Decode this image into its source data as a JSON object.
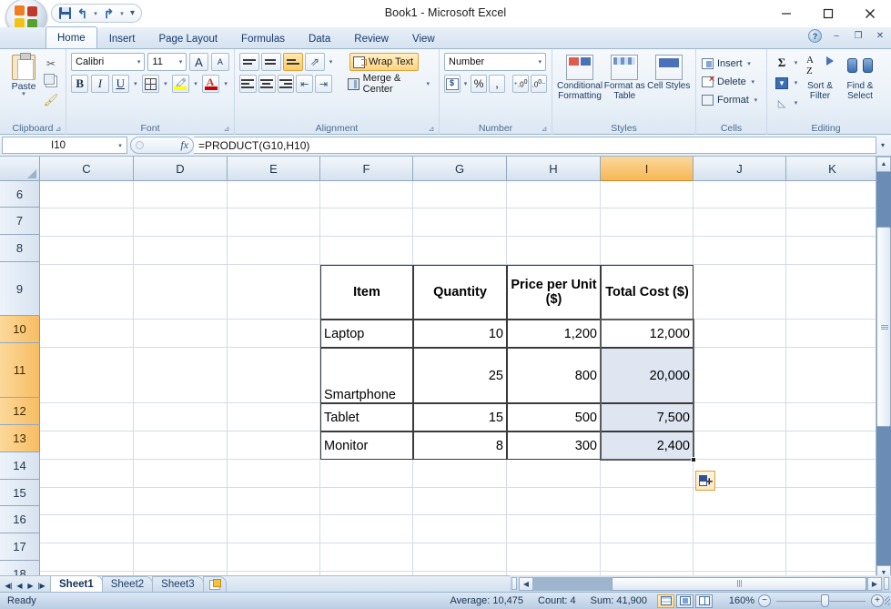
{
  "window": {
    "title": "Book1 - Microsoft Excel",
    "minimize": "−",
    "maximize": "□",
    "close": "✕"
  },
  "quick_access": {
    "save": "save-icon",
    "undo": "↰",
    "redo": "↱",
    "customize": "▾"
  },
  "ribbon": {
    "tabs": [
      {
        "label": "Home",
        "active": true
      },
      {
        "label": "Insert",
        "active": false
      },
      {
        "label": "Page Layout",
        "active": false
      },
      {
        "label": "Formulas",
        "active": false
      },
      {
        "label": "Data",
        "active": false
      },
      {
        "label": "Review",
        "active": false
      },
      {
        "label": "View",
        "active": false
      }
    ],
    "doc_controls": {
      "minimize": "–",
      "restore": "❐",
      "close": "✕"
    },
    "groups": {
      "clipboard": {
        "label": "Clipboard",
        "paste": "Paste",
        "cut": "✂",
        "copy": "copy-icon",
        "format_painter": "🖌"
      },
      "font": {
        "label": "Font",
        "font_name": "Calibri",
        "font_size": "11",
        "grow_font": "A",
        "shrink_font": "A",
        "bold": "B",
        "italic": "I",
        "underline": "U",
        "borders": "borders-icon",
        "fill_color": "fill-color-icon",
        "font_color": "A"
      },
      "alignment": {
        "label": "Alignment",
        "top_align": "top-align-icon",
        "middle_align": "middle-align-icon",
        "bottom_align": "bottom-align-icon",
        "orientation": "orientation-icon",
        "align_left": "align-left-icon",
        "align_center": "align-center-icon",
        "align_right": "align-right-icon",
        "decrease_indent": "decrease-indent-icon",
        "increase_indent": "increase-indent-icon",
        "wrap_text": "Wrap Text",
        "wrap_text_active": true,
        "merge_center": "Merge & Center"
      },
      "number": {
        "label": "Number",
        "format": "Number",
        "accounting": "accounting-icon",
        "percent": "%",
        "comma": ",",
        "increase_decimal": "increase-decimal-icon",
        "decrease_decimal": "decrease-decimal-icon"
      },
      "styles": {
        "label": "Styles",
        "conditional_formatting": "Conditional Formatting",
        "format_as_table": "Format as Table",
        "cell_styles": "Cell Styles"
      },
      "cells": {
        "label": "Cells",
        "insert": "Insert",
        "delete": "Delete",
        "format": "Format"
      },
      "editing": {
        "label": "Editing",
        "autosum": "Σ",
        "fill": "fill-icon",
        "clear": "clear-icon",
        "sort_filter": "Sort & Filter",
        "find_select": "Find & Select"
      }
    }
  },
  "formula_bar": {
    "name_box": "I10",
    "formula": "=PRODUCT(G10,H10)",
    "fx_label": "fx",
    "expand": "▾"
  },
  "grid": {
    "columns": [
      {
        "label": "C",
        "width": 103,
        "selected": false
      },
      {
        "label": "D",
        "width": 103,
        "selected": false
      },
      {
        "label": "E",
        "width": 102,
        "selected": false
      },
      {
        "label": "F",
        "width": 102,
        "selected": false
      },
      {
        "label": "G",
        "width": 103,
        "selected": false
      },
      {
        "label": "H",
        "width": 103,
        "selected": false
      },
      {
        "label": "I",
        "width": 102,
        "selected": true
      },
      {
        "label": "J",
        "width": 102,
        "selected": false
      },
      {
        "label": "K",
        "width": 102,
        "selected": false
      }
    ],
    "rows": [
      {
        "label": "6",
        "height": 30,
        "selected": false
      },
      {
        "label": "7",
        "height": 31,
        "selected": false
      },
      {
        "label": "8",
        "height": 31,
        "selected": false
      },
      {
        "label": "9",
        "height": 60,
        "selected": false
      },
      {
        "label": "10",
        "height": 31,
        "selected": true
      },
      {
        "label": "11",
        "height": 61,
        "selected": true
      },
      {
        "label": "12",
        "height": 31,
        "selected": true
      },
      {
        "label": "13",
        "height": 31,
        "selected": true
      },
      {
        "label": "14",
        "height": 31,
        "selected": false
      },
      {
        "label": "15",
        "height": 30,
        "selected": false
      },
      {
        "label": "16",
        "height": 31,
        "selected": false
      },
      {
        "label": "17",
        "height": 31,
        "selected": false
      },
      {
        "label": "18",
        "height": 31,
        "selected": false
      }
    ],
    "table": {
      "headers": [
        "Item",
        "Quantity",
        "Price per Unit ($)",
        "Total Cost ($)"
      ],
      "header_row": "9",
      "rows": [
        {
          "row": "10",
          "item": "Laptop",
          "quantity": "10",
          "price": "1,200",
          "total": "12,000"
        },
        {
          "row": "11",
          "item": "Smartphone",
          "quantity": "25",
          "price": "800",
          "total": "20,000"
        },
        {
          "row": "12",
          "item": "Tablet",
          "quantity": "15",
          "price": "500",
          "total": "7,500"
        },
        {
          "row": "13",
          "item": "Monitor",
          "quantity": "8",
          "price": "300",
          "total": "2,400"
        }
      ]
    },
    "autofill_button": "auto-fill-options-icon"
  },
  "sheets": {
    "nav_first": "◀|",
    "nav_prev": "◀",
    "nav_next": "▶",
    "nav_last": "|▶",
    "tabs": [
      {
        "label": "Sheet1",
        "active": true
      },
      {
        "label": "Sheet2",
        "active": false
      },
      {
        "label": "Sheet3",
        "active": false
      }
    ],
    "insert_sheet": "insert-worksheet-icon"
  },
  "status_bar": {
    "mode": "Ready",
    "average": "Average: 10,475",
    "count": "Count: 4",
    "sum": "Sum: 41,900",
    "view_normal": "normal-view-icon",
    "view_page_layout": "page-layout-view-icon",
    "view_page_break": "page-break-view-icon",
    "zoom": "160%",
    "zoom_out": "−",
    "zoom_in": "+"
  }
}
